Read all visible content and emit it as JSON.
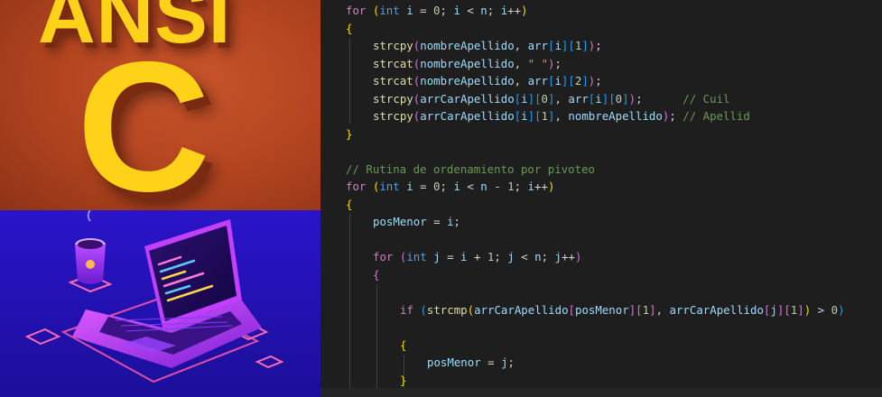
{
  "left_panel": {
    "top_logo": {
      "word": "ANSI",
      "letter": "C"
    },
    "bottom_illustration": "laptop-with-coffee-cup"
  },
  "editor": {
    "lines": [
      {
        "indent": 0,
        "tokens": [
          [
            "ctl",
            "for"
          ],
          [
            "pun",
            " "
          ],
          [
            "b1",
            "("
          ],
          [
            "kw",
            "int"
          ],
          [
            "pun",
            " "
          ],
          [
            "var",
            "i"
          ],
          [
            "pun",
            " = "
          ],
          [
            "num",
            "0"
          ],
          [
            "pun",
            "; "
          ],
          [
            "var",
            "i"
          ],
          [
            "pun",
            " < "
          ],
          [
            "var",
            "n"
          ],
          [
            "pun",
            "; "
          ],
          [
            "var",
            "i"
          ],
          [
            "pun",
            "++"
          ],
          [
            "b1",
            ")"
          ]
        ]
      },
      {
        "indent": 0,
        "tokens": [
          [
            "b1",
            "{"
          ]
        ]
      },
      {
        "indent": 1,
        "tokens": [
          [
            "fn",
            "strcpy"
          ],
          [
            "b2",
            "("
          ],
          [
            "var",
            "nombreApellido"
          ],
          [
            "pun",
            ", "
          ],
          [
            "var",
            "arr"
          ],
          [
            "b3",
            "["
          ],
          [
            "var",
            "i"
          ],
          [
            "b3",
            "]"
          ],
          [
            "b3",
            "["
          ],
          [
            "num",
            "1"
          ],
          [
            "b3",
            "]"
          ],
          [
            "b2",
            ")"
          ],
          [
            "pun",
            ";"
          ]
        ]
      },
      {
        "indent": 1,
        "tokens": [
          [
            "fn",
            "strcat"
          ],
          [
            "b2",
            "("
          ],
          [
            "var",
            "nombreApellido"
          ],
          [
            "pun",
            ", "
          ],
          [
            "str",
            "\" \""
          ],
          [
            "b2",
            ")"
          ],
          [
            "pun",
            ";"
          ]
        ]
      },
      {
        "indent": 1,
        "tokens": [
          [
            "fn",
            "strcat"
          ],
          [
            "b2",
            "("
          ],
          [
            "var",
            "nombreApellido"
          ],
          [
            "pun",
            ", "
          ],
          [
            "var",
            "arr"
          ],
          [
            "b3",
            "["
          ],
          [
            "var",
            "i"
          ],
          [
            "b3",
            "]"
          ],
          [
            "b3",
            "["
          ],
          [
            "num",
            "2"
          ],
          [
            "b3",
            "]"
          ],
          [
            "b2",
            ")"
          ],
          [
            "pun",
            ";"
          ]
        ]
      },
      {
        "indent": 1,
        "tokens": [
          [
            "fn",
            "strcpy"
          ],
          [
            "b2",
            "("
          ],
          [
            "var",
            "arrCarApellido"
          ],
          [
            "b3",
            "["
          ],
          [
            "var",
            "i"
          ],
          [
            "b3",
            "]"
          ],
          [
            "b3",
            "["
          ],
          [
            "num",
            "0"
          ],
          [
            "b3",
            "]"
          ],
          [
            "pun",
            ", "
          ],
          [
            "var",
            "arr"
          ],
          [
            "b3",
            "["
          ],
          [
            "var",
            "i"
          ],
          [
            "b3",
            "]"
          ],
          [
            "b3",
            "["
          ],
          [
            "num",
            "0"
          ],
          [
            "b3",
            "]"
          ],
          [
            "b2",
            ")"
          ],
          [
            "pun",
            ";      "
          ],
          [
            "com",
            "// Cuil"
          ]
        ]
      },
      {
        "indent": 1,
        "tokens": [
          [
            "fn",
            "strcpy"
          ],
          [
            "b2",
            "("
          ],
          [
            "var",
            "arrCarApellido"
          ],
          [
            "b3",
            "["
          ],
          [
            "var",
            "i"
          ],
          [
            "b3",
            "]"
          ],
          [
            "b3",
            "["
          ],
          [
            "num",
            "1"
          ],
          [
            "b3",
            "]"
          ],
          [
            "pun",
            ", "
          ],
          [
            "var",
            "nombreApellido"
          ],
          [
            "b2",
            ")"
          ],
          [
            "pun",
            "; "
          ],
          [
            "com",
            "// Apellid"
          ]
        ]
      },
      {
        "indent": 0,
        "tokens": [
          [
            "b1",
            "}"
          ]
        ]
      },
      {
        "indent": 0,
        "tokens": []
      },
      {
        "indent": 0,
        "tokens": [
          [
            "com",
            "// Rutina de ordenamiento por pivoteo"
          ]
        ]
      },
      {
        "indent": 0,
        "tokens": [
          [
            "ctl",
            "for"
          ],
          [
            "pun",
            " "
          ],
          [
            "b1",
            "("
          ],
          [
            "kw",
            "int"
          ],
          [
            "pun",
            " "
          ],
          [
            "var",
            "i"
          ],
          [
            "pun",
            " = "
          ],
          [
            "num",
            "0"
          ],
          [
            "pun",
            "; "
          ],
          [
            "var",
            "i"
          ],
          [
            "pun",
            " < "
          ],
          [
            "var",
            "n"
          ],
          [
            "pun",
            " - "
          ],
          [
            "num",
            "1"
          ],
          [
            "pun",
            "; "
          ],
          [
            "var",
            "i"
          ],
          [
            "pun",
            "++"
          ],
          [
            "b1",
            ")"
          ]
        ]
      },
      {
        "indent": 0,
        "tokens": [
          [
            "b1",
            "{"
          ]
        ]
      },
      {
        "indent": 1,
        "tokens": [
          [
            "var",
            "posMenor"
          ],
          [
            "pun",
            " = "
          ],
          [
            "var",
            "i"
          ],
          [
            "pun",
            ";"
          ]
        ]
      },
      {
        "indent": 1,
        "tokens": []
      },
      {
        "indent": 1,
        "tokens": [
          [
            "ctl",
            "for"
          ],
          [
            "pun",
            " "
          ],
          [
            "b2",
            "("
          ],
          [
            "kw",
            "int"
          ],
          [
            "pun",
            " "
          ],
          [
            "var",
            "j"
          ],
          [
            "pun",
            " = "
          ],
          [
            "var",
            "i"
          ],
          [
            "pun",
            " + "
          ],
          [
            "num",
            "1"
          ],
          [
            "pun",
            "; "
          ],
          [
            "var",
            "j"
          ],
          [
            "pun",
            " < "
          ],
          [
            "var",
            "n"
          ],
          [
            "pun",
            "; "
          ],
          [
            "var",
            "j"
          ],
          [
            "pun",
            "++"
          ],
          [
            "b2",
            ")"
          ]
        ]
      },
      {
        "indent": 1,
        "tokens": [
          [
            "b2",
            "{"
          ]
        ]
      },
      {
        "indent": 2,
        "tokens": []
      },
      {
        "indent": 2,
        "tokens": [
          [
            "ctl",
            "if"
          ],
          [
            "pun",
            " "
          ],
          [
            "b3",
            "("
          ],
          [
            "fn",
            "strcmp"
          ],
          [
            "b1",
            "("
          ],
          [
            "var",
            "arrCarApellido"
          ],
          [
            "b2",
            "["
          ],
          [
            "var",
            "posMenor"
          ],
          [
            "b2",
            "]"
          ],
          [
            "b2",
            "["
          ],
          [
            "num",
            "1"
          ],
          [
            "b2",
            "]"
          ],
          [
            "pun",
            ", "
          ],
          [
            "var",
            "arrCarApellido"
          ],
          [
            "b2",
            "["
          ],
          [
            "var",
            "j"
          ],
          [
            "b2",
            "]"
          ],
          [
            "b2",
            "["
          ],
          [
            "num",
            "1"
          ],
          [
            "b2",
            "]"
          ],
          [
            "b1",
            ")"
          ],
          [
            "pun",
            " > "
          ],
          [
            "num",
            "0"
          ],
          [
            "b3",
            ")"
          ]
        ]
      },
      {
        "indent": 2,
        "tokens": []
      },
      {
        "indent": 2,
        "tokens": [
          [
            "b1",
            "{"
          ]
        ]
      },
      {
        "indent": 3,
        "tokens": [
          [
            "var",
            "posMenor"
          ],
          [
            "pun",
            " = "
          ],
          [
            "var",
            "j"
          ],
          [
            "pun",
            ";"
          ]
        ]
      },
      {
        "indent": 2,
        "tokens": [
          [
            "b1",
            "}"
          ]
        ]
      }
    ]
  }
}
